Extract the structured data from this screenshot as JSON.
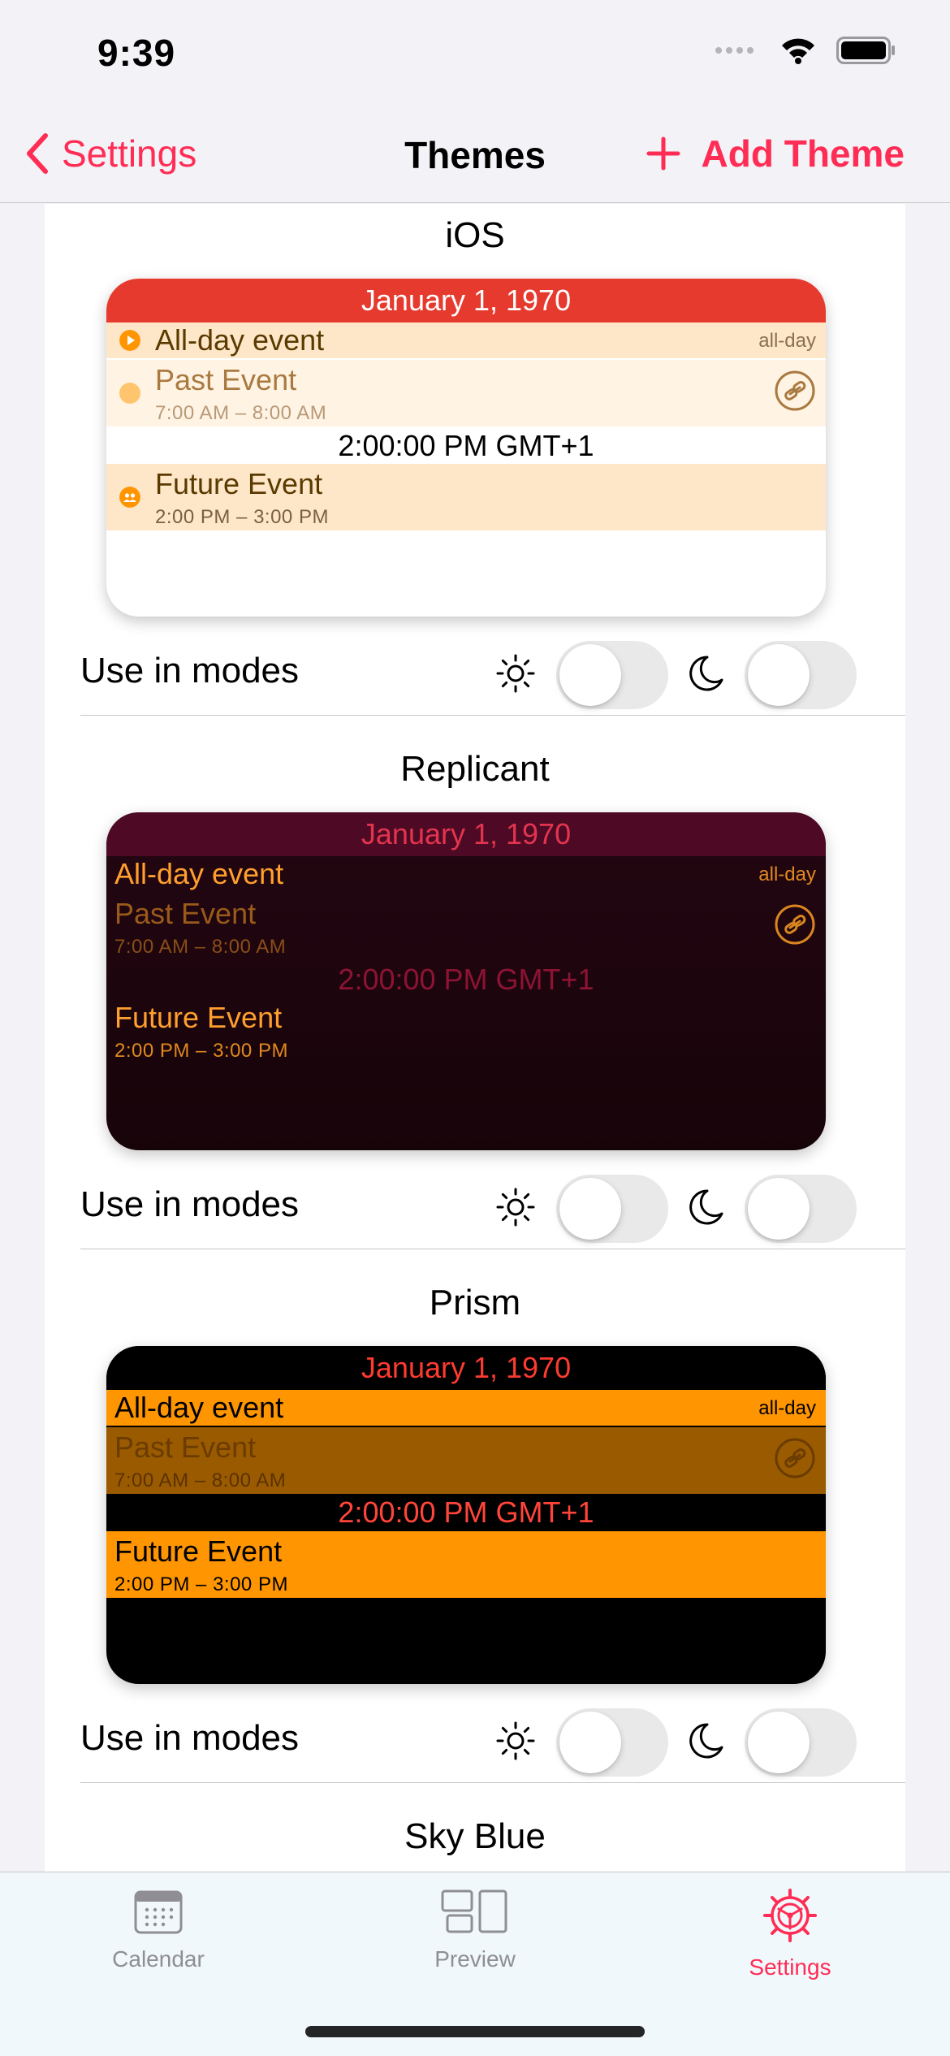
{
  "status_bar": {
    "time": "9:39",
    "icons": [
      "signal-icon",
      "wifi-icon",
      "battery-icon"
    ]
  },
  "nav": {
    "back_label": "Settings",
    "title": "Themes",
    "add_label": "Add Theme",
    "accent": "#ff2d55"
  },
  "themes": [
    {
      "name": "iOS",
      "preview": {
        "date": "January 1, 1970",
        "allday_title": "All-day event",
        "allday_label": "all-day",
        "past_title": "Past Event",
        "past_time": "7:00 AM – 8:00 AM",
        "clock": "2:00:00 PM GMT+1",
        "future_title": "Future Event",
        "future_time": "2:00 PM – 3:00 PM"
      },
      "modes_label": "Use in modes",
      "light_mode_on": false,
      "dark_mode_on": false
    },
    {
      "name": "Replicant",
      "preview": {
        "date": "January 1, 1970",
        "allday_title": "All-day event",
        "allday_label": "all-day",
        "past_title": "Past Event",
        "past_time": "7:00 AM – 8:00 AM",
        "clock": "2:00:00 PM GMT+1",
        "future_title": "Future Event",
        "future_time": "2:00 PM – 3:00 PM"
      },
      "modes_label": "Use in modes",
      "light_mode_on": false,
      "dark_mode_on": false
    },
    {
      "name": "Prism",
      "preview": {
        "date": "January 1, 1970",
        "allday_title": "All-day event",
        "allday_label": "all-day",
        "past_title": "Past Event",
        "past_time": "7:00 AM – 8:00 AM",
        "clock": "2:00:00 PM GMT+1",
        "future_title": "Future Event",
        "future_time": "2:00 PM – 3:00 PM"
      },
      "modes_label": "Use in modes",
      "light_mode_on": false,
      "dark_mode_on": false
    },
    {
      "name": "Sky Blue"
    }
  ],
  "tab_bar": {
    "items": [
      {
        "label": "Calendar",
        "icon": "calendar-icon",
        "active": false
      },
      {
        "label": "Preview",
        "icon": "preview-icon",
        "active": false
      },
      {
        "label": "Settings",
        "icon": "settings-gear-icon",
        "active": true
      }
    ]
  }
}
